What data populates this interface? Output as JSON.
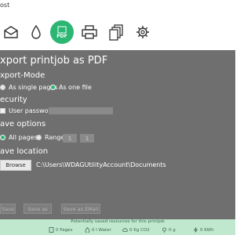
{
  "window": {
    "title": "ost"
  },
  "toolbar": {
    "items": [
      {
        "name": "mail",
        "icon": "mail-icon"
      },
      {
        "name": "drop",
        "icon": "drop-icon"
      },
      {
        "name": "pdf",
        "icon": "pdf-icon",
        "label": "PDF",
        "active": true
      },
      {
        "name": "print",
        "icon": "printer-icon"
      },
      {
        "name": "copies",
        "icon": "copies-icon"
      },
      {
        "name": "settings",
        "icon": "gear-icon"
      }
    ]
  },
  "colors": {
    "accent": "#2bb673",
    "main_bg": "#6f6f6f",
    "bottom_bg": "#bfe8cf"
  },
  "main": {
    "title": "xport printjob as PDF",
    "export_mode": {
      "heading": "xport-Mode",
      "options": [
        "As single pages",
        "As one file"
      ],
      "selected": "As one file"
    },
    "security": {
      "heading": "ecurity",
      "checkbox_label": "User password",
      "checked": false,
      "password_value": ""
    },
    "save_options": {
      "heading": "ave options",
      "options": [
        "All pages",
        "Range"
      ],
      "selected": "All pages",
      "range_from": "1",
      "range_to": "1"
    },
    "save_location": {
      "heading": "ave location",
      "browse_label": "Browse",
      "path": "C:\\Users\\WDAGUtilityAccount\\Documents"
    },
    "buttons": [
      "Save",
      "Save as",
      "Save as EMail"
    ]
  },
  "bottom": {
    "label": "Potentially saved resources for this printjob",
    "stats": [
      {
        "icon": "pages-icon",
        "value": "0 Pages"
      },
      {
        "icon": "water-icon",
        "value": "0 l Water"
      },
      {
        "icon": "co2-icon",
        "value": "0 Kg CO2"
      },
      {
        "icon": "bulb-icon",
        "value": "0 g"
      },
      {
        "icon": "energy-icon",
        "value": "0 KWh"
      }
    ]
  }
}
